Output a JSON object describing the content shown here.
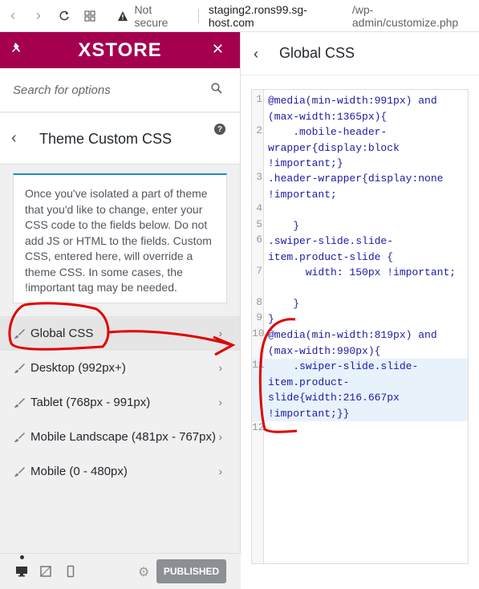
{
  "browser": {
    "not_secure": "Not secure",
    "url_host": "staging2.rons99.sg-host.com",
    "url_path": "/wp-admin/customize.php"
  },
  "sidebar": {
    "brand": "XSTORE",
    "search_placeholder": "Search for options",
    "section_title": "Theme Custom CSS",
    "description": "Once you've isolated a part of theme that you'd like to change, enter your CSS code to the fields below. Do not add JS or HTML to the fields. Custom CSS, entered here, will override a theme CSS. In some cases, the !important tag may be needed.",
    "items": [
      {
        "label": "Global CSS"
      },
      {
        "label": "Desktop (992px+)"
      },
      {
        "label": "Tablet (768px - 991px)"
      },
      {
        "label": "Mobile Landscape (481px - 767px)"
      },
      {
        "label": "Mobile (0 - 480px)"
      }
    ],
    "publish_label": "PUBLISHED"
  },
  "editor": {
    "title": "Global CSS",
    "lines": [
      "1",
      "2",
      "3",
      "4",
      "5",
      "6",
      "7",
      "8",
      "9",
      "10",
      "11",
      "12"
    ],
    "code": {
      "l1": "@media(min-width:991px) and (max-width:1365px){",
      "l2": "    .mobile-header-wrapper{display:block !important;}",
      "l3": ".header-wrapper{display:none !important;",
      "l5": "    }",
      "l6": ".swiper-slide.slide-item.product-slide {",
      "l7": "      width: 150px !important;",
      "l8": "    }",
      "l9": "}",
      "l10": "@media(min-width:819px) and (max-width:990px){",
      "l11": "    .swiper-slide.slide-item.product-slide{width:216.667px !important;}}"
    }
  },
  "colors": {
    "brand": "#a4004f",
    "annotation": "#e00000"
  }
}
